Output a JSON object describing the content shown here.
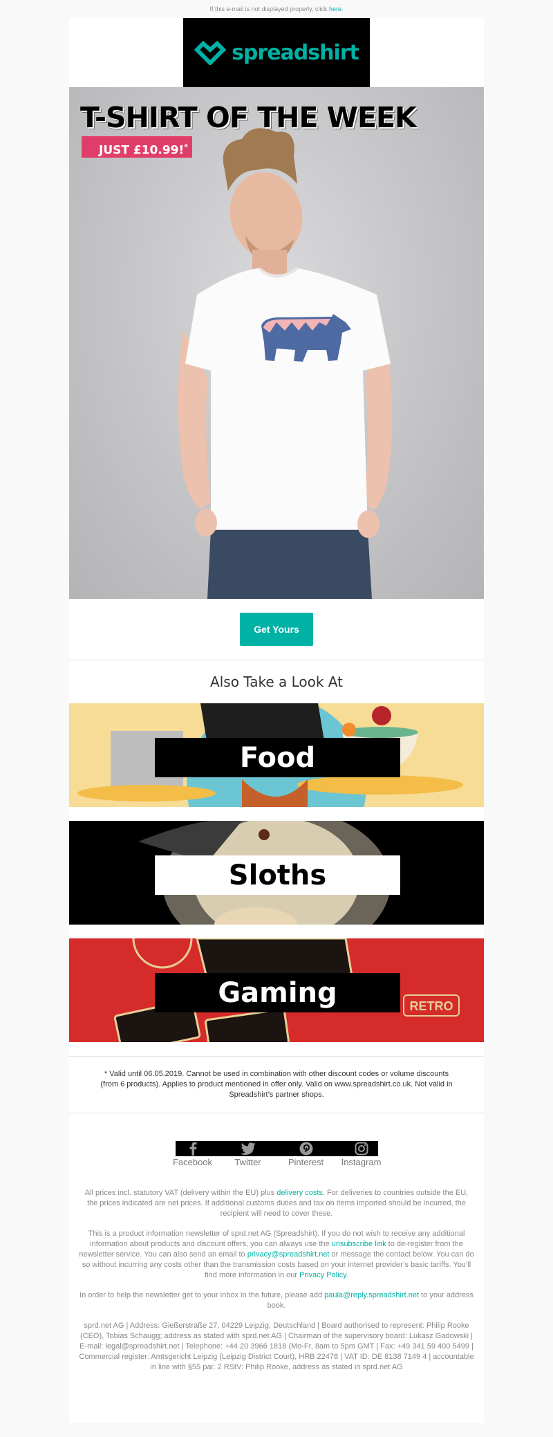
{
  "preheader": {
    "text": "If this e-mail is not displayed properly, click ",
    "link": "here."
  },
  "brand": {
    "name": "spreadshirt",
    "accent_color": "#00b2a5",
    "logo_icon": "heart-diamond-icon"
  },
  "hero": {
    "title": "T-SHIRT OF THE WEEK",
    "price_label": "JUST £10.99!",
    "price_asterisk": "*",
    "tag_color": "#e03e6a",
    "image": "man-wearing-white-bear-mountain-tshirt"
  },
  "cta": {
    "label": "Get Yours"
  },
  "also_look": {
    "title": "Also Take a Look At",
    "categories": [
      {
        "label": "Food",
        "image": "cartoon-pirate-food-illustration"
      },
      {
        "label": "Sloths",
        "image": "sloth-with-police-cap-and-burger"
      },
      {
        "label": "Gaming",
        "image": "retro-game-console-illustration"
      }
    ]
  },
  "terms": "* Valid until 06.05.2019. Cannot be used in combination with other discount codes or volume discounts (from 6 products). Applies to product mentioned in offer only. Valid on www.spreadshirt.co.uk. Not valid in Spreadshirt’s partner shops.",
  "social": [
    {
      "label": "Facebook",
      "icon": "facebook-icon"
    },
    {
      "label": "Twitter",
      "icon": "twitter-icon"
    },
    {
      "label": "Pinterest",
      "icon": "pinterest-icon"
    },
    {
      "label": "Instagram",
      "icon": "instagram-icon"
    }
  ],
  "legal": {
    "vat": {
      "before": "All prices incl. statutory VAT (delivery within the EU) plus ",
      "link": "delivery costs",
      "after": ". For deliveries to countries outside the EU, the prices indicated are net prices. If additional customs duties and tax on items imported should be incurred, the recipient will need to cover these."
    },
    "newsletter": {
      "part1": "This is a product information newsletter of sprd.net AG (Spreadshirt). If you do not wish to receive any additional information about products and discount offers, you can always use the ",
      "unsubscribe_link": "unsubscribe link",
      "part2": " to de-register from the newsletter service. You can also send an email to ",
      "privacy_email": "privacy@spreadshirt.net",
      "part3": " or message the contact below. You can do so without incurring any costs other than the transmission costs based on your internet provider’s basic tariffs. You’ll find more information in our ",
      "privacy_policy_link": "Privacy Policy",
      "part4": "."
    },
    "addressbook": {
      "before": "In order to help the newsletter get to your inbox in the future, please add ",
      "email": "paula@reply.spreadshirt.net",
      "after": " to your address book."
    },
    "imprint": "sprd.net AG | Address: Gießerstraße 27, 04229 Leipzig, Deutschland | Board authorised to represent: Philip Rooke (CEO), Tobias Schaugg; address as stated with sprd.net AG | Chairman of the supervisory board: Lukasz Gadowski | E-mail: legal@spreadshirt.net | Telephone: +44 20 3966 1818 (Mo-Fr, 8am to 5pm GMT | Fax: +49 341 59 400 5499 | Commercial register: Amtsgericht Leipzig (Leipzig District Court), HRB 22478 | VAT ID: DE 8138 7149 4 | accountable in line with §55 par. 2 RStV: Philip Rooke, address as stated in sprd.net AG"
  }
}
